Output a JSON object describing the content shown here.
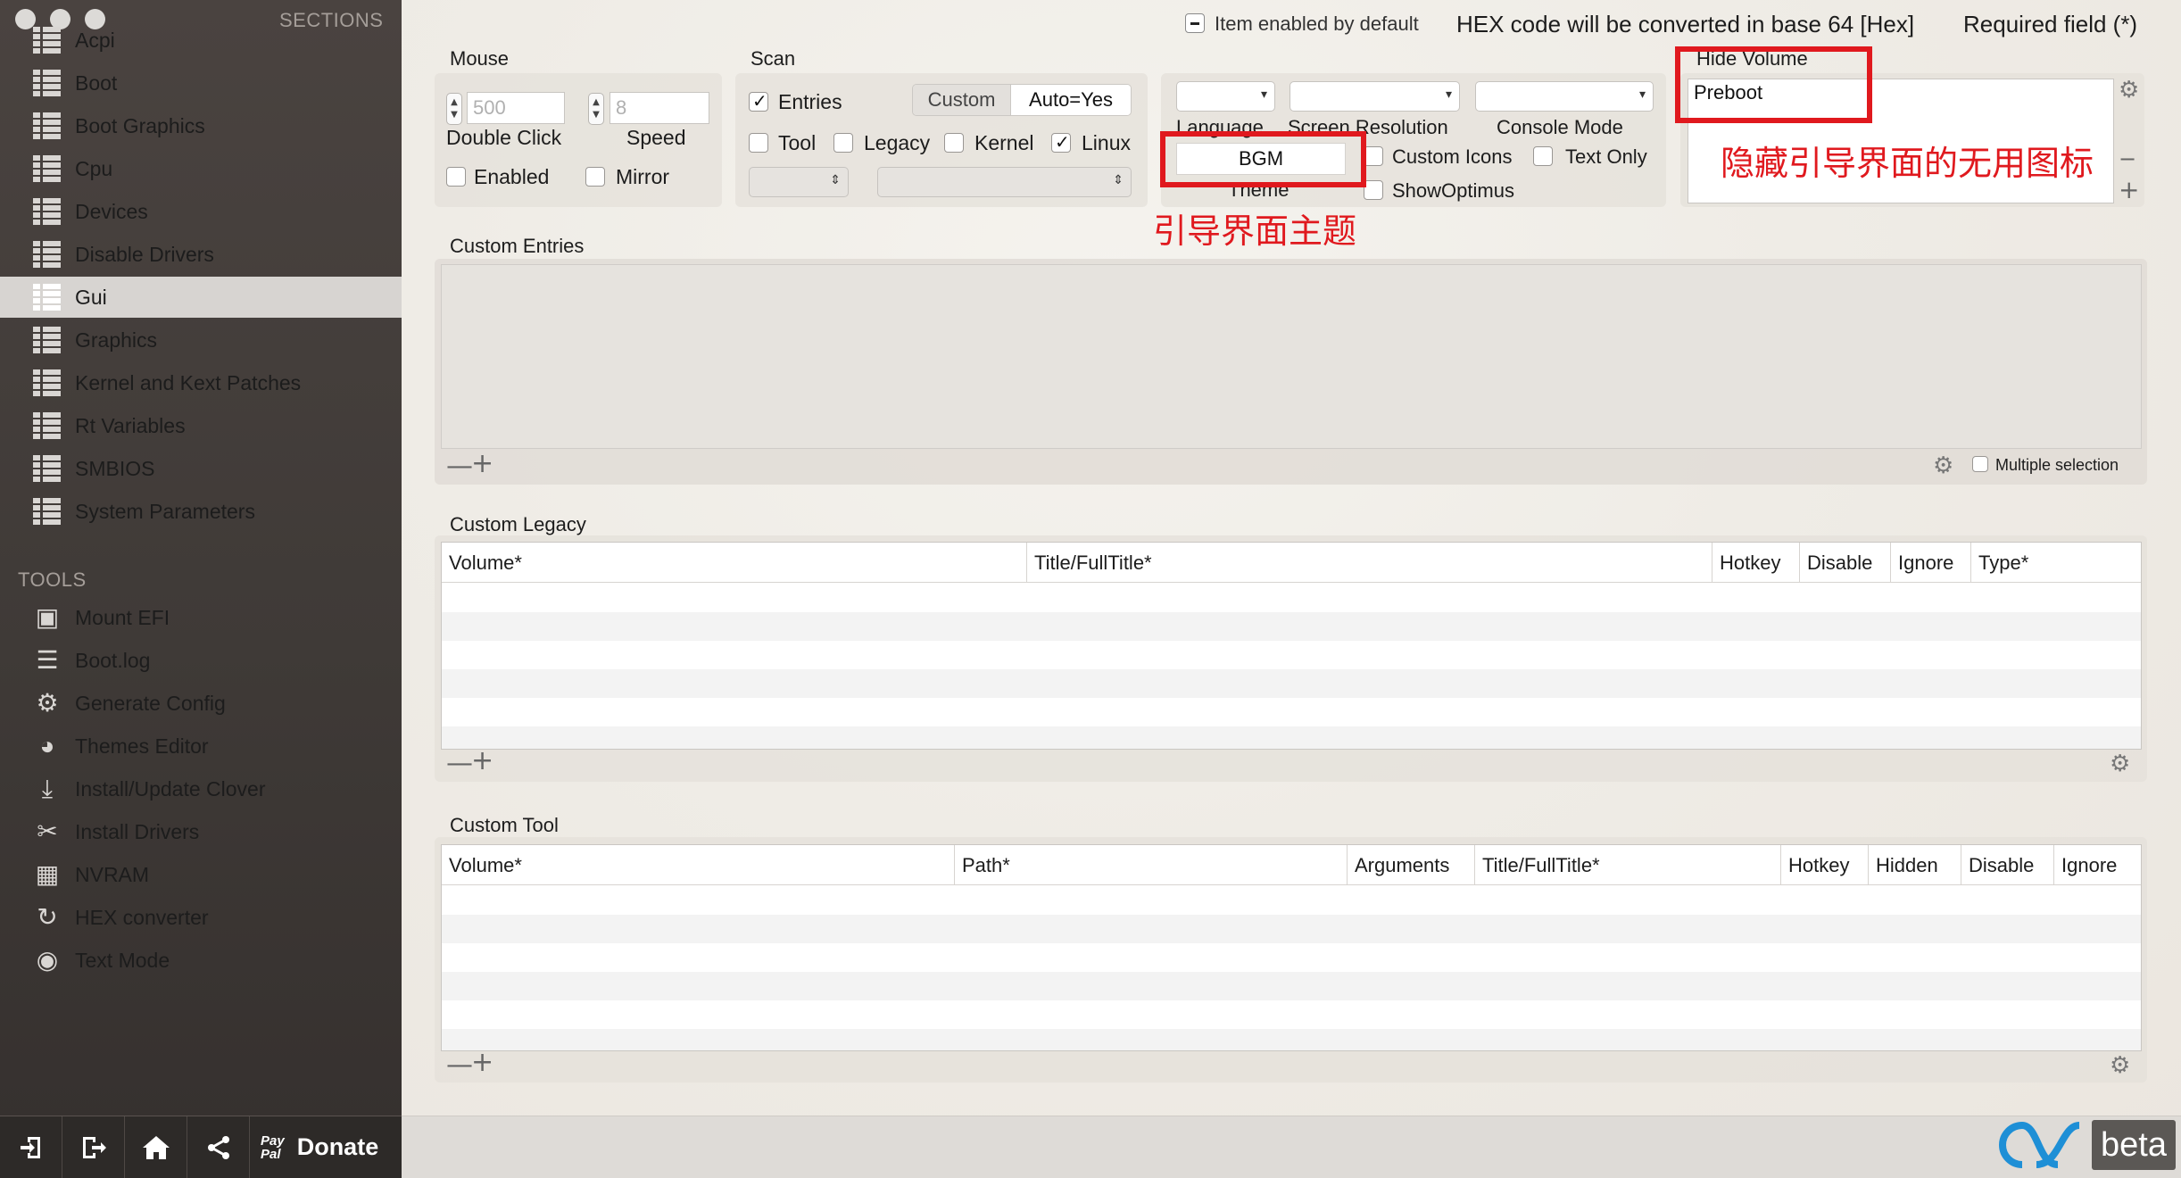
{
  "sidebar": {
    "sections_header": "SECTIONS",
    "sections": [
      {
        "label": "Acpi"
      },
      {
        "label": "Boot"
      },
      {
        "label": "Boot Graphics"
      },
      {
        "label": "Cpu"
      },
      {
        "label": "Devices"
      },
      {
        "label": "Disable Drivers"
      },
      {
        "label": "Gui",
        "selected": true
      },
      {
        "label": "Graphics"
      },
      {
        "label": "Kernel and Kext Patches"
      },
      {
        "label": "Rt Variables"
      },
      {
        "label": "SMBIOS"
      },
      {
        "label": "System Parameters"
      }
    ],
    "tools_header": "TOOLS",
    "tools": [
      {
        "label": "Mount EFI",
        "icon": "disk-icon"
      },
      {
        "label": "Boot.log",
        "icon": "log-icon"
      },
      {
        "label": "Generate Config",
        "icon": "gears-icon"
      },
      {
        "label": "Themes Editor",
        "icon": "palette-icon"
      },
      {
        "label": "Install/Update Clover",
        "icon": "download-icon"
      },
      {
        "label": "Install Drivers",
        "icon": "tools-icon"
      },
      {
        "label": "NVRAM",
        "icon": "chip-icon"
      },
      {
        "label": "HEX converter",
        "icon": "refresh-icon"
      },
      {
        "label": "Text Mode",
        "icon": "eye-icon"
      }
    ],
    "bottom": {
      "donate_label": "Donate",
      "paypal_label_1": "Pay",
      "paypal_label_2": "Pal"
    }
  },
  "header": {
    "item_enabled_default": "Item enabled by default",
    "hex_note": "HEX code will be converted in base 64 [Hex]",
    "required_note": "Required field (*)"
  },
  "mouse": {
    "title": "Mouse",
    "double_click_value": "500",
    "double_click_label": "Double Click",
    "speed_value": "8",
    "speed_label": "Speed",
    "enabled_label": "Enabled",
    "mirror_label": "Mirror"
  },
  "scan": {
    "title": "Scan",
    "entries_label": "Entries",
    "entries_checked": true,
    "segment_custom": "Custom",
    "segment_auto": "Auto=Yes",
    "tool_label": "Tool",
    "legacy_label": "Legacy",
    "kernel_label": "Kernel",
    "linux_label": "Linux",
    "linux_checked": true
  },
  "display": {
    "language_label": "Language",
    "screen_resolution_label": "Screen Resolution",
    "console_mode_label": "Console Mode",
    "theme_value": "BGM",
    "theme_label": "Theme",
    "custom_icons_label": "Custom Icons",
    "text_only_label": "Text Only",
    "show_optimus_label": "ShowOptimus"
  },
  "hide_volume": {
    "title": "Hide Volume",
    "items": [
      "Preboot"
    ]
  },
  "annotations": {
    "theme_note": "引导界面主题",
    "hide_note": "隐藏引导界面的无用图标"
  },
  "custom_entries": {
    "title": "Custom Entries",
    "multiple_selection_label": "Multiple selection"
  },
  "custom_legacy": {
    "title": "Custom Legacy",
    "columns": [
      "Volume*",
      "Title/FullTitle*",
      "Hotkey",
      "Disable",
      "Ignore",
      "Type*"
    ]
  },
  "custom_tool": {
    "title": "Custom Tool",
    "columns": [
      "Volume*",
      "Path*",
      "Arguments",
      "Title/FullTitle*",
      "Hotkey",
      "Hidden",
      "Disable",
      "Ignore"
    ]
  },
  "branding": {
    "beta_label": "beta"
  },
  "colors": {
    "annotation_red": "#e0191e",
    "sidebar_bg": "#3f3a37"
  }
}
